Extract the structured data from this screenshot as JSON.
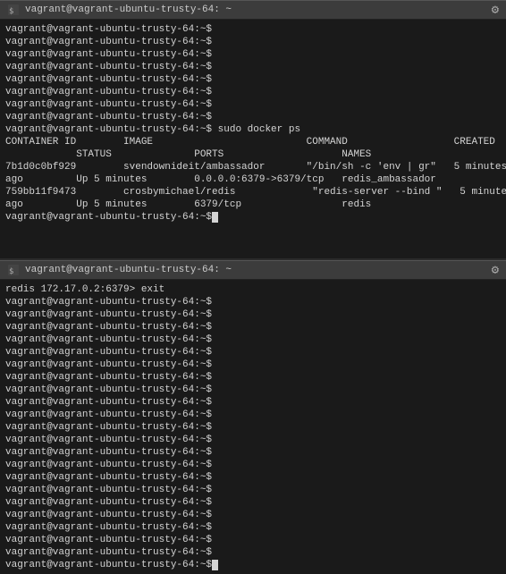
{
  "windows": [
    {
      "id": "top-window",
      "title": "vagrant@vagrant-ubuntu-trusty-64: ~",
      "lines": [
        "vagrant@vagrant-ubuntu-trusty-64:~$",
        "vagrant@vagrant-ubuntu-trusty-64:~$",
        "vagrant@vagrant-ubuntu-trusty-64:~$",
        "vagrant@vagrant-ubuntu-trusty-64:~$",
        "vagrant@vagrant-ubuntu-trusty-64:~$",
        "vagrant@vagrant-ubuntu-trusty-64:~$",
        "vagrant@vagrant-ubuntu-trusty-64:~$",
        "vagrant@vagrant-ubuntu-trusty-64:~$",
        "vagrant@vagrant-ubuntu-trusty-64:~$ sudo docker ps",
        "CONTAINER ID        IMAGE                          COMMAND                  CREATED",
        "            STATUS              PORTS                    NAMES",
        "7b1d0c0bf929        svendownideit/ambassador       \"/bin/sh -c 'env | gr\"   5 minutes",
        "ago         Up 5 minutes        0.0.0.0:6379->6379/tcp   redis_ambassador",
        "759bb11f9473        crosbymichael/redis             \"redis-server --bind \"   5 minutes",
        "ago         Up 5 minutes        6379/tcp                 redis",
        "vagrant@vagrant-ubuntu-trusty-64:~$"
      ],
      "has_cursor": true
    },
    {
      "id": "bottom-window",
      "title": "vagrant@vagrant-ubuntu-trusty-64: ~",
      "lines": [
        "redis 172.17.0.2:6379> exit",
        "vagrant@vagrant-ubuntu-trusty-64:~$",
        "vagrant@vagrant-ubuntu-trusty-64:~$",
        "vagrant@vagrant-ubuntu-trusty-64:~$",
        "vagrant@vagrant-ubuntu-trusty-64:~$",
        "vagrant@vagrant-ubuntu-trusty-64:~$",
        "vagrant@vagrant-ubuntu-trusty-64:~$",
        "vagrant@vagrant-ubuntu-trusty-64:~$",
        "vagrant@vagrant-ubuntu-trusty-64:~$",
        "vagrant@vagrant-ubuntu-trusty-64:~$",
        "vagrant@vagrant-ubuntu-trusty-64:~$",
        "vagrant@vagrant-ubuntu-trusty-64:~$",
        "vagrant@vagrant-ubuntu-trusty-64:~$",
        "vagrant@vagrant-ubuntu-trusty-64:~$",
        "vagrant@vagrant-ubuntu-trusty-64:~$",
        "vagrant@vagrant-ubuntu-trusty-64:~$",
        "vagrant@vagrant-ubuntu-trusty-64:~$",
        "vagrant@vagrant-ubuntu-trusty-64:~$",
        "vagrant@vagrant-ubuntu-trusty-64:~$",
        "vagrant@vagrant-ubuntu-trusty-64:~$",
        "vagrant@vagrant-ubuntu-trusty-64:~$",
        "vagrant@vagrant-ubuntu-trusty-64:~$",
        "vagrant@vagrant-ubuntu-trusty-64:~$"
      ],
      "has_cursor": true
    }
  ],
  "icons": {
    "terminal": "▶",
    "gear": "⚙"
  }
}
